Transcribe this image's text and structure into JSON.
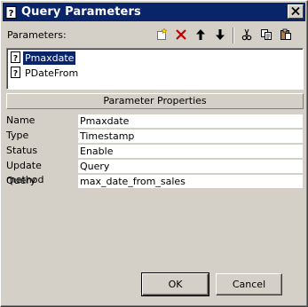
{
  "window": {
    "title": "Query Parameters",
    "title_icon": "question-doc-icon",
    "close_icon": "close-icon"
  },
  "parameters": {
    "label": "Parameters:",
    "toolbar": [
      "new-icon",
      "delete-icon",
      "move-up-icon",
      "move-down-icon",
      "cut-icon",
      "copy-icon",
      "paste-icon"
    ],
    "items": [
      {
        "label": "Pmaxdate",
        "selected": true
      },
      {
        "label": "PDateFrom",
        "selected": false
      }
    ]
  },
  "properties": {
    "header": "Parameter Properties",
    "rows": [
      {
        "name": "Name",
        "value": "Pmaxdate"
      },
      {
        "name": "Type",
        "value": "Timestamp"
      },
      {
        "name": "Status",
        "value": "Enable"
      },
      {
        "name": "Update method",
        "value": "Query"
      },
      {
        "name": "Query",
        "value": "max_date_from_sales"
      }
    ]
  },
  "buttons": {
    "ok": "OK",
    "cancel": "Cancel"
  },
  "colors": {
    "titlebar": "#0a246a",
    "face": "#d4d0c8",
    "selection": "#0a246a",
    "delete_red": "#c00000"
  }
}
